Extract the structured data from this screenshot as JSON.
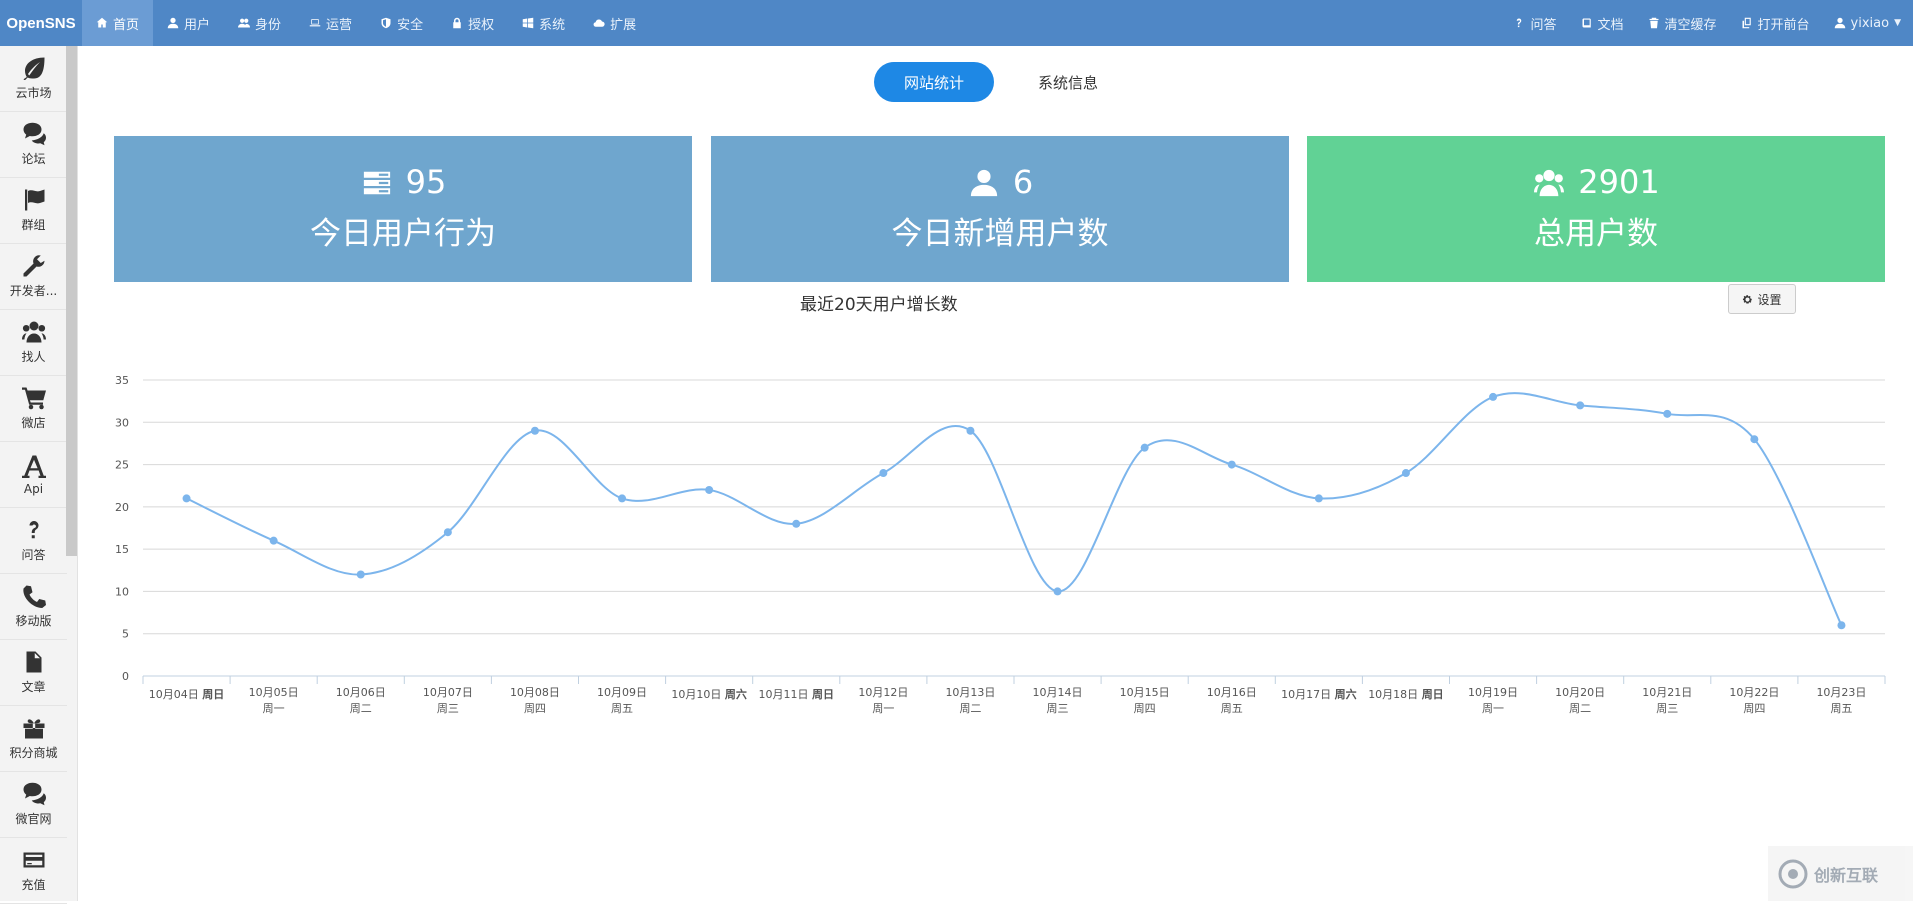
{
  "brand": "OpenSNS",
  "nav_left": [
    {
      "label": "首页",
      "icon": "home-icon",
      "active": true
    },
    {
      "label": "用户",
      "icon": "user-icon"
    },
    {
      "label": "身份",
      "icon": "users-icon"
    },
    {
      "label": "运营",
      "icon": "laptop-icon"
    },
    {
      "label": "安全",
      "icon": "shield-icon"
    },
    {
      "label": "授权",
      "icon": "lock-icon"
    },
    {
      "label": "系统",
      "icon": "windows-icon"
    },
    {
      "label": "扩展",
      "icon": "cloud-icon"
    }
  ],
  "nav_right": [
    {
      "label": "问答",
      "icon": "question-icon"
    },
    {
      "label": "文档",
      "icon": "book-icon"
    },
    {
      "label": "清空缓存",
      "icon": "trash-icon"
    },
    {
      "label": "打开前台",
      "icon": "copy-icon"
    },
    {
      "label": "yixiao",
      "icon": "user-icon"
    }
  ],
  "sidebar": [
    {
      "label": "云市场",
      "icon": "leaf-icon"
    },
    {
      "label": "论坛",
      "icon": "comments-icon"
    },
    {
      "label": "群组",
      "icon": "flag-icon"
    },
    {
      "label": "开发者...",
      "icon": "wrench-icon"
    },
    {
      "label": "找人",
      "icon": "group-icon"
    },
    {
      "label": "微店",
      "icon": "cart-icon"
    },
    {
      "label": "Api",
      "icon": "font-icon"
    },
    {
      "label": "问答",
      "icon": "question-icon"
    },
    {
      "label": "移动版",
      "icon": "phone-icon"
    },
    {
      "label": "文章",
      "icon": "file-icon"
    },
    {
      "label": "积分商城",
      "icon": "gift-icon"
    },
    {
      "label": "微官网",
      "icon": "comments-icon"
    },
    {
      "label": "充值",
      "icon": "credit-card-icon"
    }
  ],
  "tabs": [
    {
      "label": "网站统计",
      "active": true
    },
    {
      "label": "系统信息"
    }
  ],
  "cards": [
    {
      "value": "95",
      "label": "今日用户行为",
      "icon": "tasks-icon",
      "color": "#6fa6ce"
    },
    {
      "value": "6",
      "label": "今日新增用户数",
      "icon": "user-icon",
      "color": "#6fa6ce"
    },
    {
      "value": "2901",
      "label": "总用户数",
      "icon": "group-icon",
      "color": "#61d295"
    }
  ],
  "settings_label": "设置",
  "watermark": "创新互联",
  "chart_data": {
    "type": "line",
    "title": "最近20天用户增长数",
    "ylim": [
      0,
      35
    ],
    "yticks": [
      0,
      5,
      10,
      15,
      20,
      25,
      30,
      35
    ],
    "grid": true,
    "categories": [
      {
        "date": "10月04日",
        "day": "周日"
      },
      {
        "date": "10月05日",
        "day": "周一"
      },
      {
        "date": "10月06日",
        "day": "周二"
      },
      {
        "date": "10月07日",
        "day": "周三"
      },
      {
        "date": "10月08日",
        "day": "周四"
      },
      {
        "date": "10月09日",
        "day": "周五"
      },
      {
        "date": "10月10日",
        "day": "周六"
      },
      {
        "date": "10月11日",
        "day": "周日"
      },
      {
        "date": "10月12日",
        "day": "周一"
      },
      {
        "date": "10月13日",
        "day": "周二"
      },
      {
        "date": "10月14日",
        "day": "周三"
      },
      {
        "date": "10月15日",
        "day": "周四"
      },
      {
        "date": "10月16日",
        "day": "周五"
      },
      {
        "date": "10月17日",
        "day": "周六"
      },
      {
        "date": "10月18日",
        "day": "周日"
      },
      {
        "date": "10月19日",
        "day": "周一"
      },
      {
        "date": "10月20日",
        "day": "周二"
      },
      {
        "date": "10月21日",
        "day": "周三"
      },
      {
        "date": "10月22日",
        "day": "周四"
      },
      {
        "date": "10月23日",
        "day": "周五"
      }
    ],
    "series": [
      {
        "values": [
          21,
          16,
          12,
          17,
          29,
          21,
          22,
          18,
          24,
          29,
          10,
          27,
          25,
          21,
          24,
          33,
          32,
          31,
          28,
          6
        ],
        "color": "#7cb5ec"
      }
    ]
  }
}
